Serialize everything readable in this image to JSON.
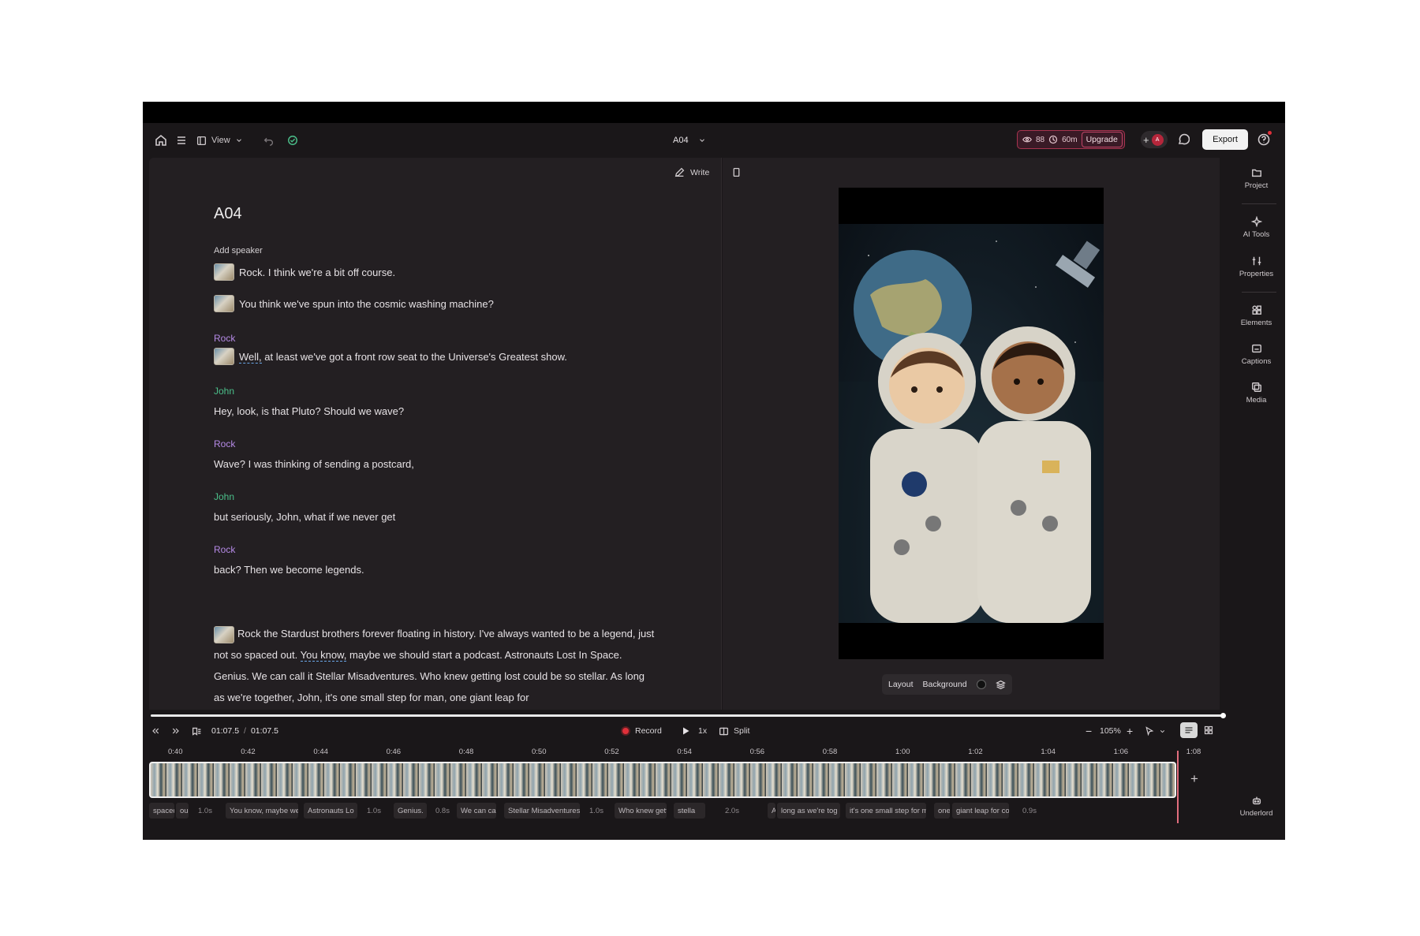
{
  "topbar": {
    "view_label": "View",
    "project_name": "A04",
    "usage_credits": "88",
    "usage_minutes": "60m",
    "upgrade_label": "Upgrade",
    "avatar_initial": "A",
    "export_label": "Export"
  },
  "editor": {
    "write_label": "Write",
    "doc_title": "A04",
    "add_speaker": "Add speaker",
    "lines": [
      {
        "text": "Rock. I think we're a bit off course."
      },
      {
        "text": "You think we've spun into the cosmic washing machine?"
      },
      {
        "speaker": "Rock",
        "text_start": "Well,",
        "text_rest": " at least we've got a front row seat to the Universe's Greatest show."
      },
      {
        "speaker": "John",
        "text": "Hey, look, is that Pluto? Should we wave?"
      },
      {
        "speaker": "Rock",
        "text": "Wave? I was thinking of sending a postcard,"
      },
      {
        "speaker": "John",
        "text": "but seriously, John, what if we never get"
      },
      {
        "speaker": "Rock",
        "text": "back? Then we become legends."
      }
    ],
    "paragraph": {
      "part1": "Rock the Stardust brothers forever floating in history. I've always wanted to be a legend, just not so spaced out. ",
      "underlined": "You know,",
      "part2": " maybe we should start a podcast. Astronauts Lost In Space. Genius. We can call it Stellar Misadventures. Who knew getting lost could be so stellar. As long as we're together, John, it's one small step for man, one giant leap for"
    }
  },
  "preview": {
    "layout_label": "Layout",
    "background_label": "Background"
  },
  "sidebar": {
    "items": [
      "Project",
      "AI Tools",
      "Properties",
      "Elements",
      "Captions",
      "Media"
    ],
    "bottom": "Underlord"
  },
  "controls": {
    "current_time": "01:07.5",
    "separator": "/",
    "total_time": "01:07.5",
    "record_label": "Record",
    "speed_label": "1x",
    "split_label": "Split",
    "zoom_label": "105%"
  },
  "timeline": {
    "ticks": [
      "0:40",
      "0:42",
      "0:44",
      "0:46",
      "0:48",
      "0:50",
      "0:52",
      "0:54",
      "0:56",
      "0:58",
      "1:00",
      "1:02",
      "1:04",
      "1:06",
      "1:08"
    ],
    "captions": [
      "spaced",
      "ou",
      "You know, maybe we",
      "Astronauts Lo",
      "Genius.",
      "We can ca",
      "Stellar Misadventures",
      "Who knew gett",
      "stella",
      "A",
      "long as we're tog",
      "it's one small step for m",
      "one",
      "giant leap for cor"
    ],
    "durations": [
      "1.0s",
      "1.0s",
      "0.8s",
      "1.0s",
      "2.0s",
      "0.9s"
    ]
  },
  "colors": {
    "rock_speaker": "#b58ae6",
    "john_speaker": "#4bbf8a",
    "accent_upgrade": "#c24567",
    "record_red": "#e0303a"
  }
}
